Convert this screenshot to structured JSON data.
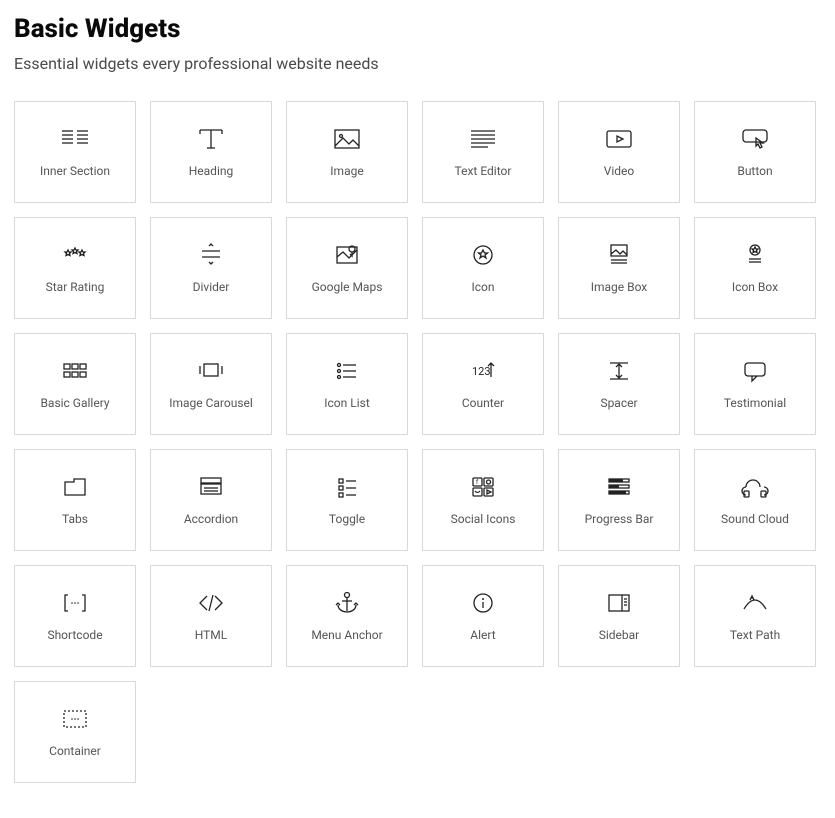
{
  "header": {
    "title": "Basic Widgets",
    "subtitle": "Essential widgets every professional website needs"
  },
  "widgets": [
    {
      "id": "inner-section",
      "label": "Inner Section"
    },
    {
      "id": "heading",
      "label": "Heading"
    },
    {
      "id": "image",
      "label": "Image"
    },
    {
      "id": "text-editor",
      "label": "Text Editor"
    },
    {
      "id": "video",
      "label": "Video"
    },
    {
      "id": "button",
      "label": "Button"
    },
    {
      "id": "star-rating",
      "label": "Star Rating"
    },
    {
      "id": "divider",
      "label": "Divider"
    },
    {
      "id": "google-maps",
      "label": "Google Maps"
    },
    {
      "id": "icon",
      "label": "Icon"
    },
    {
      "id": "image-box",
      "label": "Image Box"
    },
    {
      "id": "icon-box",
      "label": "Icon Box"
    },
    {
      "id": "basic-gallery",
      "label": "Basic Gallery"
    },
    {
      "id": "image-carousel",
      "label": "Image Carousel"
    },
    {
      "id": "icon-list",
      "label": "Icon List"
    },
    {
      "id": "counter",
      "label": "Counter"
    },
    {
      "id": "spacer",
      "label": "Spacer"
    },
    {
      "id": "testimonial",
      "label": "Testimonial"
    },
    {
      "id": "tabs",
      "label": "Tabs"
    },
    {
      "id": "accordion",
      "label": "Accordion"
    },
    {
      "id": "toggle",
      "label": "Toggle"
    },
    {
      "id": "social-icons",
      "label": "Social Icons"
    },
    {
      "id": "progress-bar",
      "label": "Progress Bar"
    },
    {
      "id": "sound-cloud",
      "label": "Sound Cloud"
    },
    {
      "id": "shortcode",
      "label": "Shortcode"
    },
    {
      "id": "html",
      "label": "HTML"
    },
    {
      "id": "menu-anchor",
      "label": "Menu Anchor"
    },
    {
      "id": "alert",
      "label": "Alert"
    },
    {
      "id": "sidebar",
      "label": "Sidebar"
    },
    {
      "id": "text-path",
      "label": "Text Path"
    },
    {
      "id": "container",
      "label": "Container"
    }
  ]
}
